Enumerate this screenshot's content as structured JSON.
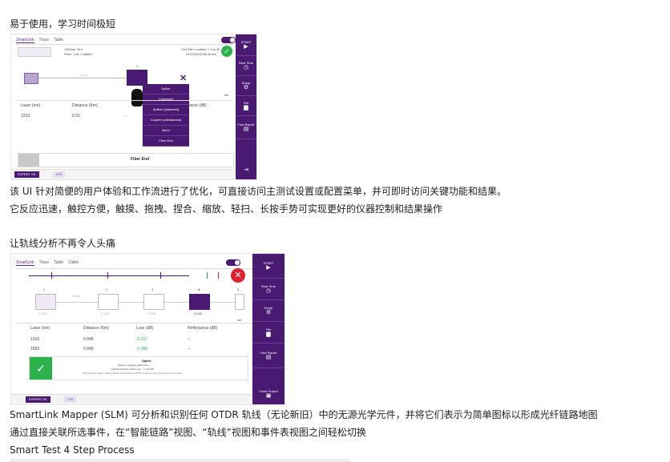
{
  "section1": {
    "heading": "易于使用，学习时间极短",
    "caption1": "该 UI 针对简便的用户体验和工作流进行了优化，可直接访问主测试设置或配置菜单，并可即时访问关键功能和结果。",
    "caption2": "它反应迅速，触控方便，触摸、拖拽、捏合、缩放、轻扫、长按手势可实现更好的仪器控制和结果操作"
  },
  "section2": {
    "heading": "让轨线分析不再令人头痛",
    "caption1": "SmartLink Mapper (SLM) 可分析和识别任何 OTDR 轨线（无论新旧）中的无源光学元件，并将它们表示为简单图标以形成光纤链路地图",
    "caption2": "通过直接关联所选事件，在“智能链路”视图、“轨线”视图和事件表视图之间轻松切换",
    "caption3": "Smart Test 4 Step Process"
  },
  "shot1": {
    "tabs": [
      "SmartLink",
      "Trace",
      "Table"
    ],
    "fiber_info": [
      "1310nm  Vrrn",
      "Fiber: 1.8x  1.48800"
    ],
    "location": [
      "Cell Site Location -> Loc B",
      "01/10/2020  08:40 am"
    ],
    "event_number": "1",
    "distance_label": "0.0 0",
    "menu": [
      "Splice",
      "Connector",
      "Splitter (balanced)",
      "Coupler (unbalanced)",
      "Bend",
      "Fiber End"
    ],
    "table_headers": [
      "Laser (nm)",
      "Distance (Km)",
      "ance (dB)"
    ],
    "table_row": [
      "1310",
      "0.02",
      "-"
    ],
    "fiber_end": "Fiber End",
    "unit": "km",
    "bottom_left": "EXPERT OK",
    "bottom_right": "LTS",
    "sidebar": [
      {
        "label": "START",
        "icon": "▶"
      },
      {
        "label": "Real Time",
        "icon": "◷"
      },
      {
        "label": "Setup",
        "icon": "⚙"
      },
      {
        "label": "File",
        "icon": "▆"
      },
      {
        "label": "Fast Report",
        "icon": "▤"
      },
      {
        "label": "",
        "icon": "⇥"
      }
    ],
    "colors": {
      "accent": "#4a1a73",
      "ok": "#2bb24c"
    }
  },
  "shot2": {
    "tabs": [
      "SmartLink",
      "Trace",
      "Table",
      "Cable"
    ],
    "event_numbers": [
      "1",
      "2",
      "3",
      "4",
      "5"
    ],
    "event_dists": [
      "0.000",
      "0.028",
      "0.026",
      "0.030",
      "0.046"
    ],
    "table_headers": [
      "Laser (nm)",
      "Distance (Km)",
      "Loss (dB)",
      "Reflectance (dB)"
    ],
    "table_rows": [
      [
        "1310",
        "0.046",
        "-0.317",
        "--"
      ],
      [
        "1550",
        "0.046",
        "-0.383",
        "--"
      ]
    ],
    "splice_title": "Splice",
    "splice_lines": [
      "Gainer ( negative splice loss )",
      "Fail threshold for splice loss : > 0.30 dB",
      "Different fiber types, please perform bidirectional OTDR measurement for accurate loss value"
    ],
    "unit": "km",
    "bottom_left": "EXPERT OK",
    "bottom_right": "LTS",
    "sidebar": [
      {
        "label": "START",
        "icon": "▶"
      },
      {
        "label": "Real Time",
        "icon": "◷"
      },
      {
        "label": "Setup",
        "icon": "⚙"
      },
      {
        "label": "File",
        "icon": "▆"
      },
      {
        "label": "Fast Report",
        "icon": "▤"
      },
      {
        "label": "Close Project",
        "icon": "▣"
      }
    ],
    "colors": {
      "accent": "#4a1a73",
      "ok": "#2bb24c",
      "fail": "#e0202c"
    }
  }
}
